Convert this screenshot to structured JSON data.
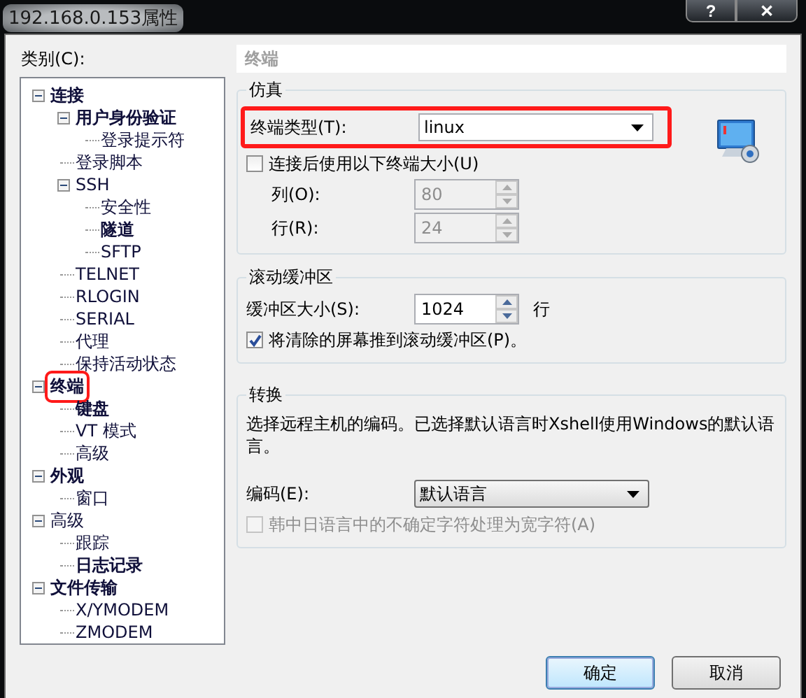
{
  "window": {
    "title": "192.168.0.153属性",
    "controls": [
      {
        "kind": "help",
        "label": "?"
      },
      {
        "kind": "close",
        "label": "✕"
      }
    ]
  },
  "category_label": "类别(C):",
  "tree": [
    {
      "label": "连接",
      "bold": true,
      "highlighted": false,
      "expanded": true,
      "children": [
        {
          "label": "用户身份验证",
          "bold": true,
          "highlighted": false,
          "expanded": true,
          "children": [
            {
              "label": "登录提示符",
              "bold": false,
              "highlighted": false
            }
          ]
        },
        {
          "label": "登录脚本",
          "bold": false,
          "highlighted": false
        },
        {
          "label": "SSH",
          "bold": false,
          "highlighted": false,
          "expanded": true,
          "children": [
            {
              "label": "安全性",
              "bold": false,
              "highlighted": false
            },
            {
              "label": "隧道",
              "bold": true,
              "highlighted": false
            },
            {
              "label": "SFTP",
              "bold": false,
              "highlighted": false
            }
          ]
        },
        {
          "label": "TELNET",
          "bold": false,
          "highlighted": false
        },
        {
          "label": "RLOGIN",
          "bold": false,
          "highlighted": false
        },
        {
          "label": "SERIAL",
          "bold": false,
          "highlighted": false
        },
        {
          "label": "代理",
          "bold": false,
          "highlighted": false
        },
        {
          "label": "保持活动状态",
          "bold": false,
          "highlighted": false
        }
      ]
    },
    {
      "label": "终端",
      "bold": true,
      "highlighted": true,
      "expanded": true,
      "children": [
        {
          "label": "键盘",
          "bold": true,
          "highlighted": false
        },
        {
          "label": "VT 模式",
          "bold": false,
          "highlighted": false
        },
        {
          "label": "高级",
          "bold": false,
          "highlighted": false
        }
      ]
    },
    {
      "label": "外观",
      "bold": true,
      "highlighted": false,
      "expanded": true,
      "children": [
        {
          "label": "窗口",
          "bold": false,
          "highlighted": false
        }
      ]
    },
    {
      "label": "高级",
      "bold": false,
      "highlighted": false,
      "expanded": true,
      "children": [
        {
          "label": "跟踪",
          "bold": false,
          "highlighted": false
        },
        {
          "label": "日志记录",
          "bold": true,
          "highlighted": false
        }
      ]
    },
    {
      "label": "文件传输",
      "bold": true,
      "highlighted": false,
      "expanded": true,
      "children": [
        {
          "label": "X/YMODEM",
          "bold": false,
          "highlighted": false
        },
        {
          "label": "ZMODEM",
          "bold": false,
          "highlighted": false
        }
      ]
    }
  ],
  "panel_title": "终端",
  "emulation": {
    "title": "仿真",
    "terminal_type": {
      "label": "终端类型(T):",
      "value": "linux",
      "highlighted": true
    },
    "use_size": {
      "label": "连接后使用以下终端大小(U)",
      "checked": false
    },
    "columns": {
      "label": "列(O):",
      "value": "80",
      "disabled": true
    },
    "rows": {
      "label": "行(R):",
      "value": "24",
      "disabled": true
    }
  },
  "scrollback": {
    "title": "滚动缓冲区",
    "buffer_size": {
      "label": "缓冲区大小(S):",
      "value": "1024",
      "unit": "行",
      "disabled": false
    },
    "push_cleared": {
      "label": "将清除的屏幕推到滚动缓冲区(P)。",
      "checked": true
    }
  },
  "translation": {
    "title": "转换",
    "description": "选择远程主机的编码。已选择默认语言时Xshell使用Windows的默认语言。",
    "encoding": {
      "label": "编码(E):",
      "value": "默认语言"
    },
    "cjk_ambiguous": {
      "label": "韩中日语言中的不确定字符处理为宽字符(A)",
      "checked": false,
      "disabled": true
    }
  },
  "buttons": [
    {
      "label": "确定",
      "default": true
    },
    {
      "label": "取消",
      "default": false
    }
  ]
}
